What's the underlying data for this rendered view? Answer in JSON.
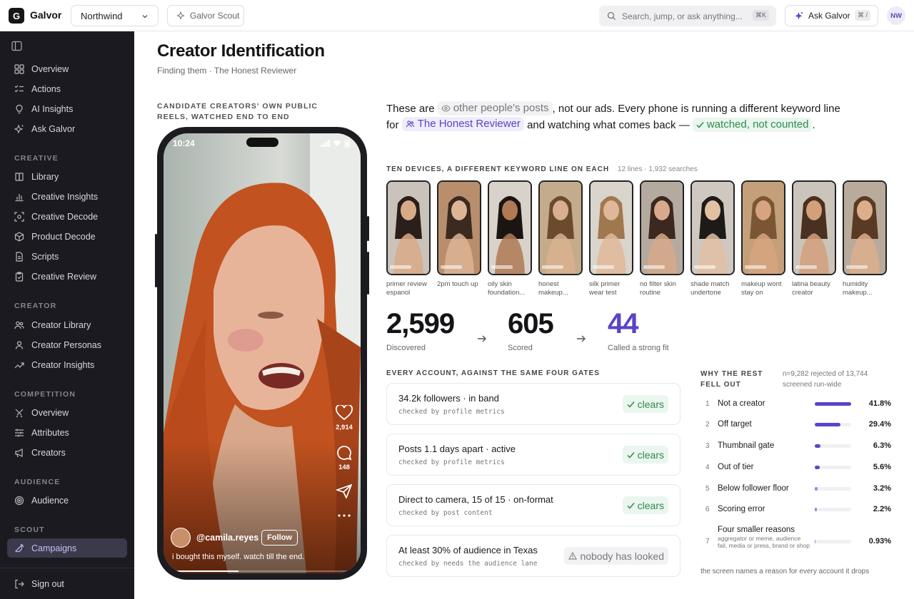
{
  "topbar": {
    "logo_letter": "G",
    "brand": "Galvor",
    "workspace": "Northwind",
    "scout_button": "Galvor Scout",
    "search_placeholder": "Search, jump, or ask anything...",
    "search_shortcut": "⌘K",
    "ask_button": "Ask Galvor",
    "ask_shortcut": "⌘ /",
    "user_initials": "NW"
  },
  "sidebar": {
    "top_items": [
      {
        "label": "Overview",
        "icon": "grid-icon"
      },
      {
        "label": "Actions",
        "icon": "checklist-icon"
      },
      {
        "label": "AI Insights",
        "icon": "lightbulb-icon"
      },
      {
        "label": "Ask Galvor",
        "icon": "sparkle-icon"
      }
    ],
    "creative_label": "CREATIVE",
    "creative_items": [
      {
        "label": "Library",
        "icon": "book-icon"
      },
      {
        "label": "Creative Insights",
        "icon": "bar-chart-icon"
      },
      {
        "label": "Creative Decode",
        "icon": "scan-icon"
      },
      {
        "label": "Product Decode",
        "icon": "box-icon"
      },
      {
        "label": "Scripts",
        "icon": "document-icon"
      },
      {
        "label": "Creative Review",
        "icon": "clipboard-check-icon"
      }
    ],
    "creator_label": "CREATOR",
    "creator_items": [
      {
        "label": "Creator Library",
        "icon": "users-icon"
      },
      {
        "label": "Creator Personas",
        "icon": "user-icon"
      },
      {
        "label": "Creator Insights",
        "icon": "trend-icon"
      }
    ],
    "competition_label": "COMPETITION",
    "competition_items": [
      {
        "label": "Overview",
        "icon": "crossed-swords-icon"
      },
      {
        "label": "Attributes",
        "icon": "sliders-icon"
      },
      {
        "label": "Creators",
        "icon": "megaphone-icon"
      }
    ],
    "audience_label": "AUDIENCE",
    "audience_items": [
      {
        "label": "Audience",
        "icon": "target-icon"
      }
    ],
    "scout_label": "SCOUT",
    "scout_items": [
      {
        "label": "Campaigns",
        "icon": "satellite-icon",
        "active": true
      }
    ],
    "sign_out": "Sign out"
  },
  "main": {
    "title": "Creator Identification",
    "subtitle": "Finding them · The Honest Reviewer",
    "phone_label": "CANDIDATE CREATORS' OWN PUBLIC REELS, WATCHED END TO END",
    "phone": {
      "time": "10:24",
      "likes": "2,914",
      "comments": "148",
      "handle": "@camila.reyes",
      "follow": "Follow",
      "caption": "i bought this myself. watch till the end."
    },
    "intro": {
      "p1": "These are ",
      "chip1": "other people's posts",
      "p2": ", not our ads. Every phone is running a different keyword line for ",
      "chip2": "The Honest Reviewer",
      "p3": " and watching what comes back — ",
      "chip3": "watched, not counted",
      "p4": "."
    },
    "devices_label": "TEN DEVICES, A DIFFERENT KEYWORD LINE ON EACH",
    "devices_meta": "12 lines · 1,932 searches",
    "devices": [
      {
        "caption": "primer review espanol",
        "bg": "#c9c3bb",
        "skin": "#d9aa88",
        "hair": "#2a1f1a"
      },
      {
        "caption": "2pm touch up",
        "bg": "#b98e6c",
        "skin": "#dcb595",
        "hair": "#3a2a20"
      },
      {
        "caption": "oily skin foundation...",
        "bg": "#d8d2ca",
        "skin": "#b07a55",
        "hair": "#1a1512"
      },
      {
        "caption": "honest makeup...",
        "bg": "#c4ab8c",
        "skin": "#d9b08f",
        "hair": "#6b4a2e"
      },
      {
        "caption": "silk primer wear test",
        "bg": "#d9d4cc",
        "skin": "#e0b899",
        "hair": "#a0784f"
      },
      {
        "caption": "no filter skin routine",
        "bg": "#b5aaa0",
        "skin": "#d8a98a",
        "hair": "#3b2820"
      },
      {
        "caption": "shade match undertone",
        "bg": "#cfc8c0",
        "skin": "#e2c0a4",
        "hair": "#1e1a18"
      },
      {
        "caption": "makeup wont stay on",
        "bg": "#c3a07a",
        "skin": "#d6a47f",
        "hair": "#7b5634"
      },
      {
        "caption": "latina beauty creator",
        "bg": "#cbc4ba",
        "skin": "#d3a07c",
        "hair": "#4a3020"
      },
      {
        "caption": "humidity makeup...",
        "bg": "#b9ab9c",
        "skin": "#dcae8c",
        "hair": "#5a3a24"
      }
    ],
    "funnel": [
      {
        "value": "2,599",
        "label": "Discovered"
      },
      {
        "value": "605",
        "label": "Scored"
      },
      {
        "value": "44",
        "label": "Called a strong fit"
      }
    ],
    "gates_label": "EVERY ACCOUNT, AGAINST THE SAME FOUR GATES",
    "gates": [
      {
        "title": "34.2k followers · in band",
        "sub": "checked by profile metrics",
        "status": "clears"
      },
      {
        "title": "Posts 1.1 days apart · active",
        "sub": "checked by profile metrics",
        "status": "clears"
      },
      {
        "title": "Direct to camera, 15 of 15 · on-format",
        "sub": "checked by post content",
        "status": "clears"
      },
      {
        "title": "At least 30% of audience in Texas",
        "sub": "checked by needs the audience lane",
        "status": "nobody has looked"
      }
    ],
    "why_label": "WHY THE REST FELL OUT",
    "why_meta": "n=9,282 rejected of 13,744 screened run-wide",
    "reasons": [
      {
        "n": "1",
        "name": "Not a creator",
        "pct": "41.8%",
        "share": 0.418
      },
      {
        "n": "2",
        "name": "Off target",
        "pct": "29.4%",
        "share": 0.294
      },
      {
        "n": "3",
        "name": "Thumbnail gate",
        "pct": "6.3%",
        "share": 0.063
      },
      {
        "n": "4",
        "name": "Out of tier",
        "pct": "5.6%",
        "share": 0.056
      },
      {
        "n": "5",
        "name": "Below follower floor",
        "pct": "3.2%",
        "share": 0.032
      },
      {
        "n": "6",
        "name": "Scoring error",
        "pct": "2.2%",
        "share": 0.022
      },
      {
        "n": "7",
        "name": "Four smaller reasons",
        "sub": "aggregator or meme, audience fail, media or press, brand or shop",
        "pct": "0.93%",
        "share": 0.0093
      }
    ],
    "why_foot": "the screen names a reason for every account it drops"
  }
}
